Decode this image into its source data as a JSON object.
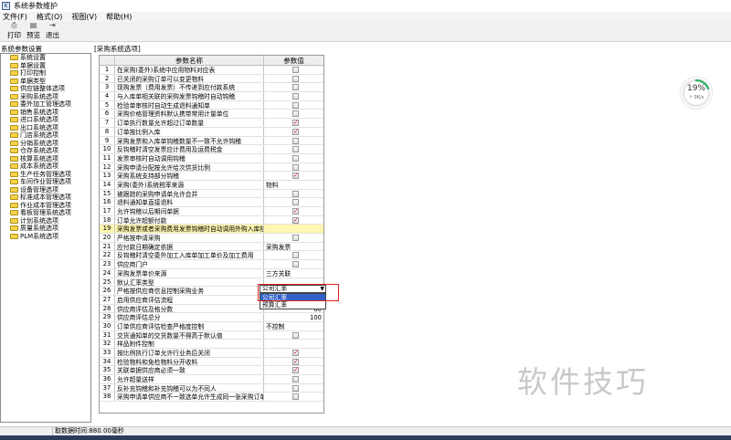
{
  "window": {
    "title": "系统参数维护"
  },
  "menu": {
    "items": [
      "文件(F)",
      "格式(O)",
      "视图(V)",
      "帮助(H)"
    ]
  },
  "toolbar": {
    "buttons": [
      {
        "label": "打印"
      },
      {
        "label": "预览"
      },
      {
        "label": "退出"
      }
    ]
  },
  "left_panel": {
    "header": "系统参数设置",
    "items": [
      "系统设置",
      "单据设置",
      "打印控制",
      "单据类型",
      "供应链整体选项",
      "采购系统选项",
      "委外加工管理选项",
      "销售系统选项",
      "进口系统选项",
      "出口系统选项",
      "门店系统选项",
      "分销系统选项",
      "仓存系统选项",
      "核算系统选项",
      "成本系统选项",
      "生产任务管理选项",
      "车间作业管理选项",
      "设备管理选项",
      "标准成本管理选项",
      "作业成本管理选项",
      "看板管理系统选项",
      "计划系统选项",
      "质量系统选项",
      "PLM系统选项"
    ]
  },
  "grid": {
    "section_title": "[采购系统选项]",
    "col_name": "参数名称",
    "col_value": "参数值",
    "rows": [
      {
        "no": "1",
        "name": "在采购(委外)系统中应用物料对应表",
        "value": "",
        "type": "checkbox",
        "checked": false
      },
      {
        "no": "2",
        "name": "已关闭的采购订单可以变更物料",
        "value": "",
        "type": "checkbox",
        "checked": false
      },
      {
        "no": "3",
        "name": "现购发票（费用发票）不传递到应付款系统",
        "value": "",
        "type": "checkbox",
        "checked": false
      },
      {
        "no": "4",
        "name": "与入库单相关联的采购发票钩稽时自动钩稽",
        "value": "",
        "type": "checkbox",
        "checked": false
      },
      {
        "no": "5",
        "name": "检验单审核时自动生成退料通知单",
        "value": "",
        "type": "checkbox",
        "checked": false
      },
      {
        "no": "6",
        "name": "采购价格管理资料默认携带常用计量单位",
        "value": "",
        "type": "checkbox",
        "checked": false
      },
      {
        "no": "7",
        "name": "订单执行数量允许超过订单数量",
        "value": "",
        "type": "checkbox",
        "checked": true
      },
      {
        "no": "8",
        "name": "订单按比例入库",
        "value": "",
        "type": "checkbox",
        "checked": true
      },
      {
        "no": "9",
        "name": "采购发票和入库单钩稽数量不一致不允许钩稽",
        "value": "",
        "type": "checkbox",
        "checked": false
      },
      {
        "no": "10",
        "name": "反钩稽时清空发票应计费用及运费税金",
        "value": "",
        "type": "checkbox",
        "checked": false
      },
      {
        "no": "11",
        "name": "发票审核时自动调用钩稽",
        "value": "",
        "type": "checkbox",
        "checked": false
      },
      {
        "no": "12",
        "name": "采购申请分配按允许给次供货比例",
        "value": "",
        "type": "checkbox",
        "checked": false
      },
      {
        "no": "13",
        "name": "采购系统支持部分钩稽",
        "value": "",
        "type": "checkbox",
        "checked": true
      },
      {
        "no": "14",
        "name": "采购(委外)系统税率来源",
        "value": "物料",
        "type": "text"
      },
      {
        "no": "15",
        "name": "被跟踪的采购申请单允许合并",
        "value": "",
        "type": "checkbox",
        "checked": false
      },
      {
        "no": "16",
        "name": "退料通知单直接退料",
        "value": "",
        "type": "checkbox",
        "checked": false
      },
      {
        "no": "17",
        "name": "允许钩稽以后期间单据",
        "value": "",
        "type": "checkbox",
        "checked": true
      },
      {
        "no": "18",
        "name": "订单允许超额付款",
        "value": "",
        "type": "checkbox",
        "checked": true
      },
      {
        "no": "19",
        "name": "采购发票或者采购费用发票钩稽时自动调用外购入库核",
        "value": "",
        "type": "highlight"
      },
      {
        "no": "20",
        "name": "严格按申请采购",
        "value": "",
        "type": "checkbox",
        "checked": false
      },
      {
        "no": "21",
        "name": "应付款日期确定依据",
        "value": "采购发票",
        "type": "text"
      },
      {
        "no": "22",
        "name": "反钩稽时清空委外加工入库单加工单价及加工费用",
        "value": "",
        "type": "checkbox",
        "checked": false
      },
      {
        "no": "23",
        "name": "供应商门户",
        "value": "",
        "type": "checkbox",
        "checked": false
      },
      {
        "no": "24",
        "name": "采购发票单价来源",
        "value": "三方关联",
        "type": "text"
      },
      {
        "no": "25",
        "name": "默认汇率类型",
        "value": "公司汇率",
        "type": "select"
      },
      {
        "no": "26",
        "name": "严格按供应商信息控制采购业务",
        "value": "",
        "type": "text"
      },
      {
        "no": "27",
        "name": "启用供应商评估流程",
        "value": "",
        "type": "text"
      },
      {
        "no": "28",
        "name": "供应商评估及格分数",
        "value": "60",
        "type": "number"
      },
      {
        "no": "29",
        "name": "供应商评估总分",
        "value": "100",
        "type": "number"
      },
      {
        "no": "30",
        "name": "订单供应商评估检查严格度控制",
        "value": "不控制",
        "type": "text"
      },
      {
        "no": "31",
        "name": "交货通知单的交货数量不得高于默认值",
        "value": "",
        "type": "checkbox",
        "checked": false
      },
      {
        "no": "32",
        "name": "样品附件控制",
        "value": "",
        "type": "text"
      },
      {
        "no": "33",
        "name": "按比例执行订单允许行业务后关闭",
        "value": "",
        "type": "checkbox",
        "checked": true
      },
      {
        "no": "34",
        "name": "检验物料和免检物料分开收料",
        "value": "",
        "type": "checkbox",
        "checked": true
      },
      {
        "no": "35",
        "name": "关联单据供应商必须一致",
        "value": "",
        "type": "checkbox",
        "checked": true
      },
      {
        "no": "36",
        "name": "允许超量送样",
        "value": "",
        "type": "checkbox",
        "checked": false
      },
      {
        "no": "37",
        "name": "反补充钩稽和补充钩稽可以为不同人",
        "value": "",
        "type": "checkbox",
        "checked": false
      },
      {
        "no": "38",
        "name": "采购申请单供应商不一致选单允许生成同一张采购订单",
        "value": "",
        "type": "checkbox",
        "checked": false
      }
    ]
  },
  "dropdown": {
    "selected": "公司汇率",
    "options": [
      "公司汇率",
      "预算汇率"
    ],
    "highlighted_index": 0
  },
  "progress": {
    "percent": 19,
    "label": "19%",
    "speed": "0K/s"
  },
  "watermark": "软件技巧",
  "status": {
    "text": "取数据时间:880.00毫秒"
  },
  "colors": {
    "check_mark": "#d21f1f",
    "row_highlight": "#fff7b0",
    "selection": "#3262c8",
    "red_box": "#e02020",
    "progress_ring": "#3cb371"
  }
}
